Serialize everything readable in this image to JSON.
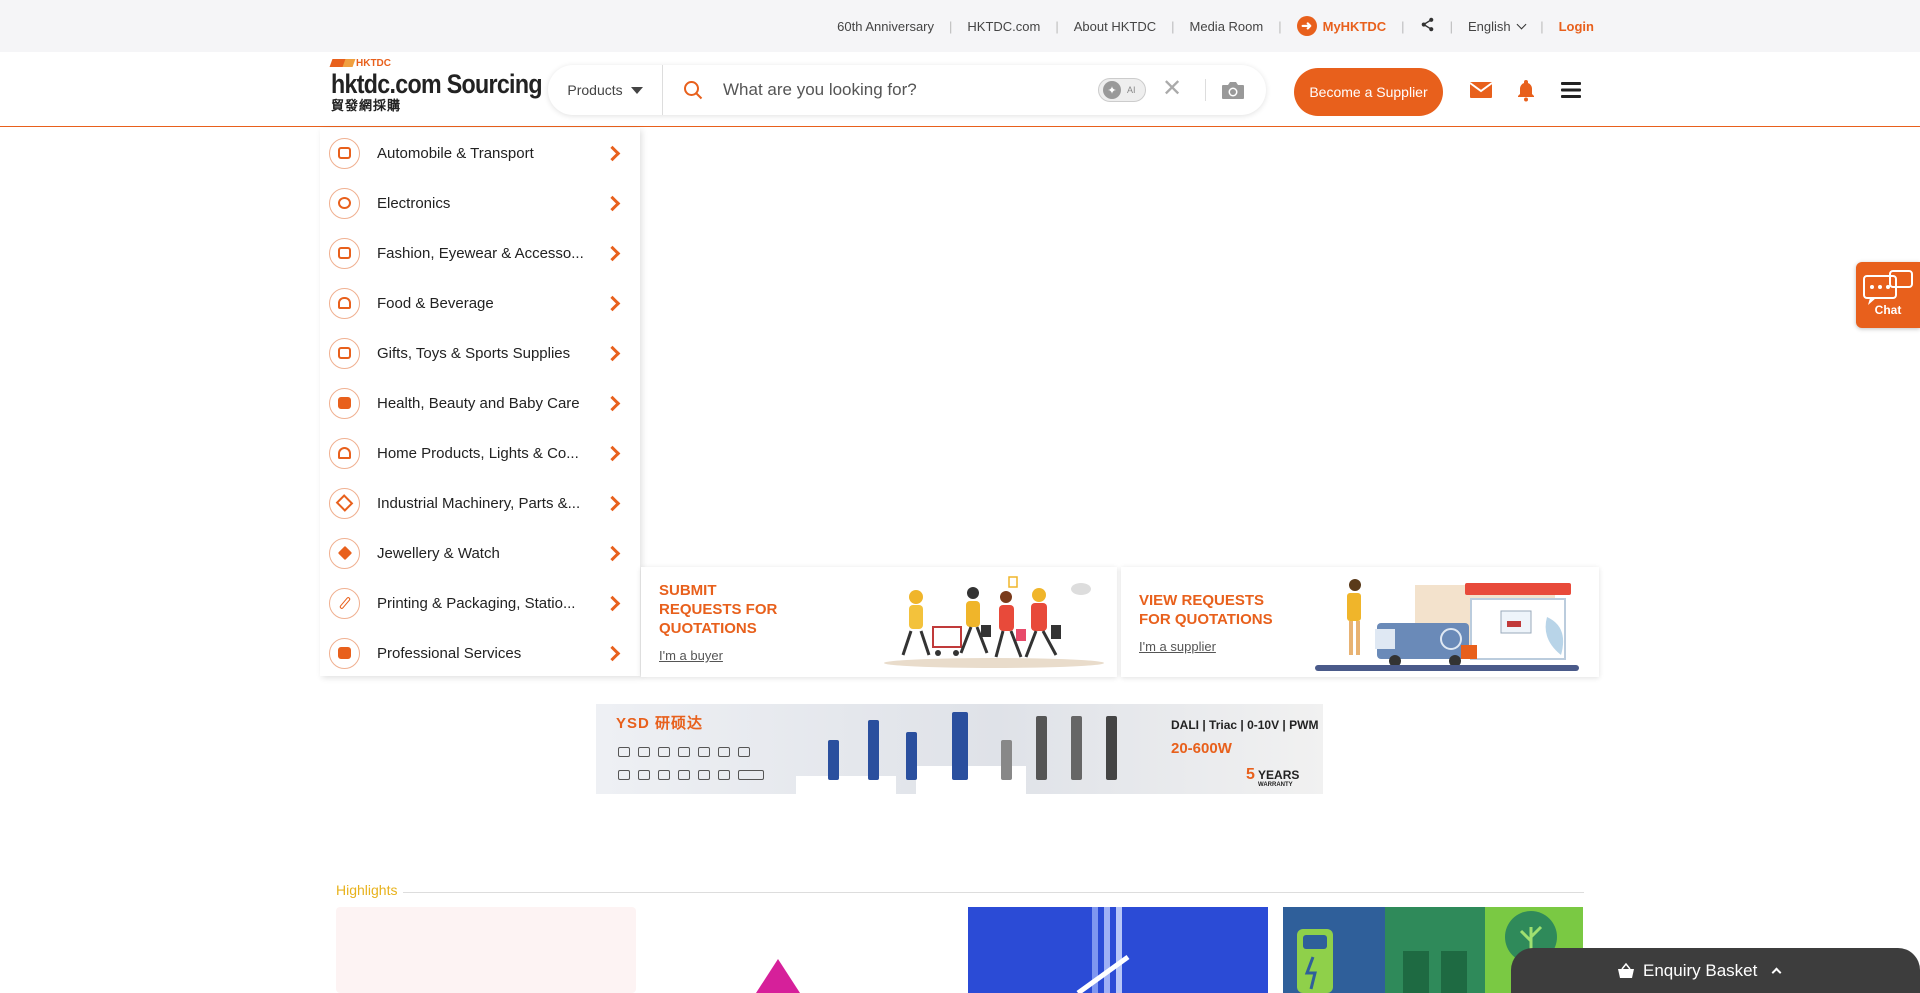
{
  "topbar": {
    "links": [
      "60th Anniversary",
      "HKTDC.com",
      "About HKTDC",
      "Media Room"
    ],
    "my_label": "MyHKTDC",
    "language": "English",
    "login": "Login"
  },
  "header": {
    "logo_brand": "HKTDC",
    "logo_main": "hktdc.com Sourcing",
    "logo_cn": "貿發網採購",
    "products_label": "Products",
    "search_placeholder": "What are you looking for?",
    "ai_label": "AI",
    "become_supplier": "Become a Supplier"
  },
  "menu": {
    "items": [
      {
        "label": "Automobile & Transport",
        "icon": "car-icon"
      },
      {
        "label": "Electronics",
        "icon": "electronics-icon"
      },
      {
        "label": "Fashion, Eyewear & Accesso...",
        "icon": "fashion-icon"
      },
      {
        "label": "Food & Beverage",
        "icon": "burger-icon"
      },
      {
        "label": "Gifts, Toys & Sports Supplies",
        "icon": "gift-icon"
      },
      {
        "label": "Health, Beauty and Baby Care",
        "icon": "health-kit-icon"
      },
      {
        "label": "Home Products, Lights & Co...",
        "icon": "lamp-icon"
      },
      {
        "label": "Industrial Machinery, Parts &...",
        "icon": "tools-icon"
      },
      {
        "label": "Jewellery & Watch",
        "icon": "diamond-icon"
      },
      {
        "label": "Printing & Packaging, Statio...",
        "icon": "pen-icon"
      },
      {
        "label": "Professional Services",
        "icon": "briefcase-icon"
      }
    ]
  },
  "rfq": {
    "submit_title_1": "SUBMIT",
    "submit_title_2": "REQUESTS FOR",
    "submit_title_3": "QUOTATIONS",
    "submit_link": "I'm a buyer",
    "view_title_1": "VIEW REQUESTS",
    "view_title_2": "FOR QUOTATIONS",
    "view_link": "I'm a supplier"
  },
  "banner": {
    "brand": "YSD 研硕达",
    "spec": "DALI | Triac | 0-10V | PWM",
    "wattage": "20-600W",
    "warranty_num": "5",
    "warranty_text": "YEARS",
    "warranty_sub": "WARRANTY"
  },
  "highlights": {
    "label": "Highlights"
  },
  "chat": {
    "label": "Chat"
  },
  "basket": {
    "label": "Enquiry Basket"
  },
  "colors": {
    "accent": "#e8601c",
    "highlight_label": "#e8b21c",
    "basket_bg": "#3d3d3d"
  }
}
